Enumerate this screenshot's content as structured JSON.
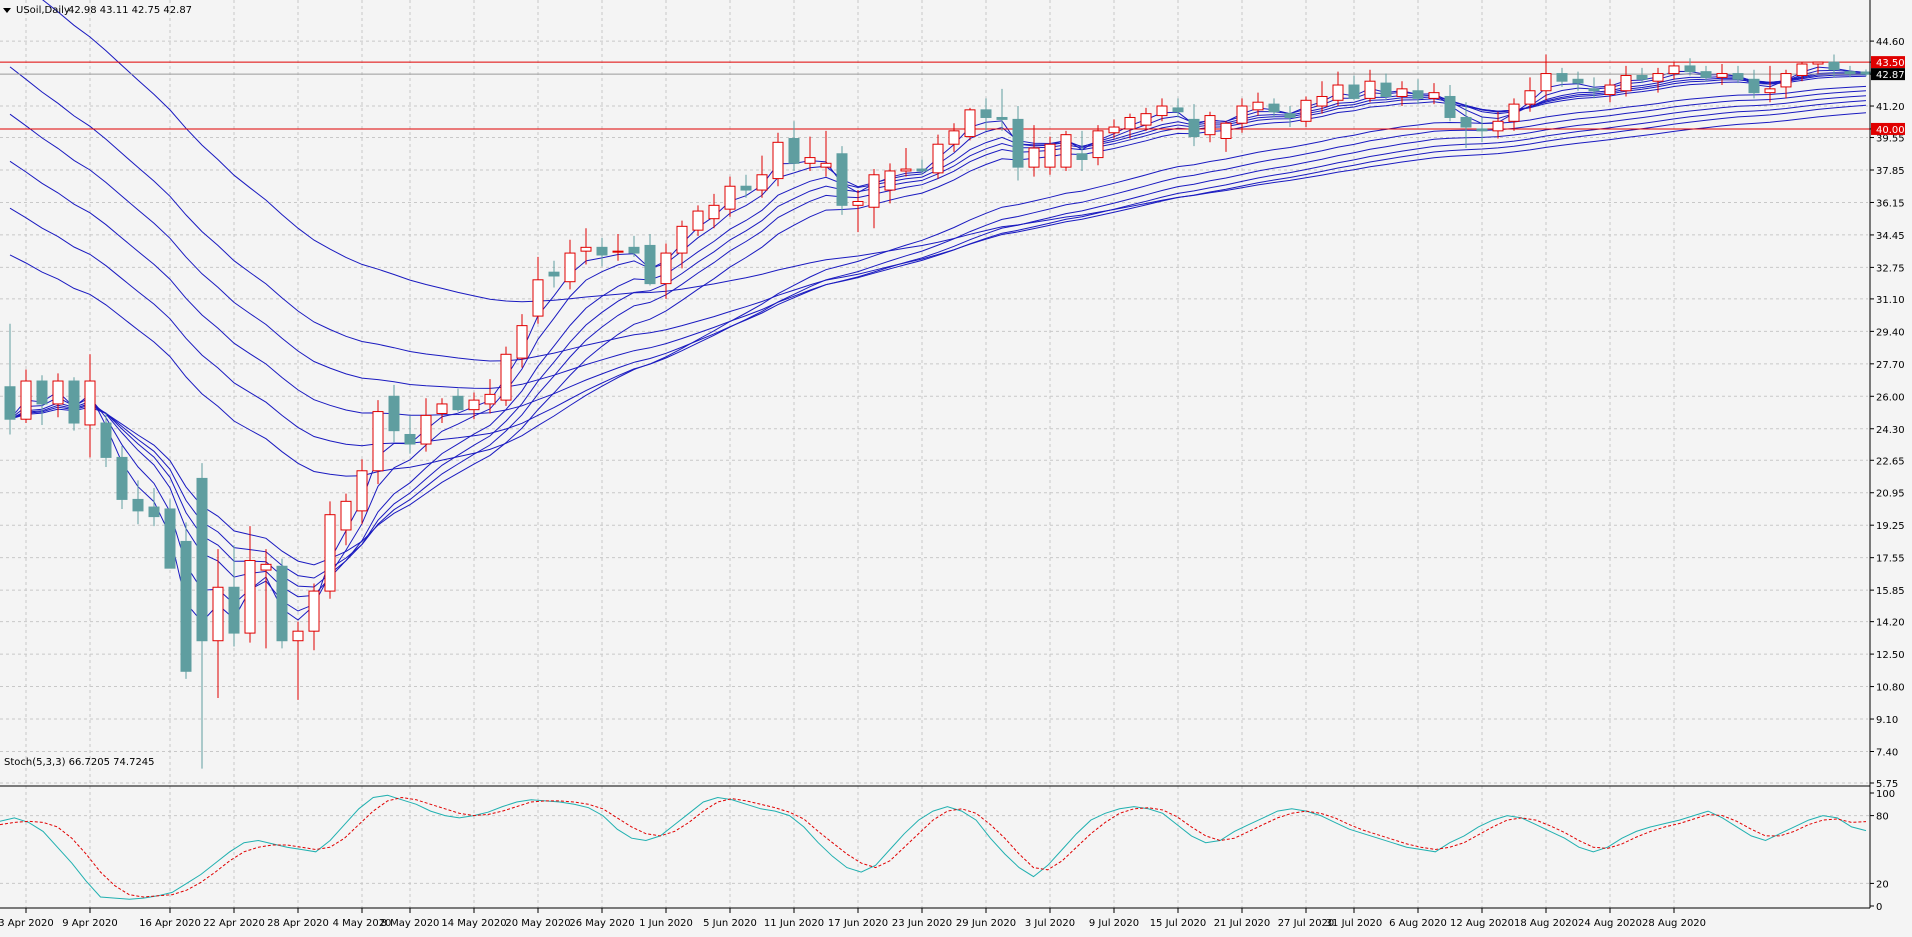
{
  "chart_data": {
    "type": "candlestick",
    "header": {
      "symbol": "USoil,Daily",
      "ohlc": "42.98 43.11 42.75 42.87"
    },
    "y_axis": {
      "range": [
        5.75,
        45.6
      ],
      "ticks": [
        "44.60",
        "43.50",
        "42.87",
        "41.20",
        "40.00",
        "39.55",
        "37.85",
        "36.15",
        "34.45",
        "32.75",
        "31.10",
        "29.40",
        "27.70",
        "26.00",
        "24.30",
        "22.65",
        "20.95",
        "19.25",
        "17.55",
        "15.85",
        "14.20",
        "12.50",
        "10.80",
        "9.10",
        "7.40",
        "5.75"
      ]
    },
    "price_lines": [
      {
        "label": "43.50",
        "value": 43.5,
        "color": "#e00000"
      },
      {
        "label": "40.00",
        "value": 40.0,
        "color": "#e00000"
      }
    ],
    "current_price": {
      "label": "42.87",
      "value": 42.87
    },
    "x_axis": {
      "labels": [
        "3 Apr 2020",
        "9 Apr 2020",
        "16 Apr 2020",
        "22 Apr 2020",
        "28 Apr 2020",
        "4 May 2020",
        "8 May 2020",
        "14 May 2020",
        "20 May 2020",
        "26 May 2020",
        "1 Jun 2020",
        "5 Jun 2020",
        "11 Jun 2020",
        "17 Jun 2020",
        "23 Jun 2020",
        "29 Jun 2020",
        "3 Jul 2020",
        "9 Jul 2020",
        "15 Jul 2020",
        "21 Jul 2020",
        "27 Jul 2020",
        "31 Jul 2020",
        "6 Aug 2020",
        "12 Aug 2020",
        "18 Aug 2020",
        "24 Aug 2020",
        "28 Aug 2020"
      ],
      "label_bar_index": [
        1,
        5,
        10,
        14,
        18,
        22,
        25,
        29,
        33,
        37,
        41,
        45,
        49,
        53,
        57,
        61,
        65,
        69,
        73,
        77,
        81,
        84,
        88,
        92,
        96,
        100,
        104
      ]
    },
    "candles": [
      [
        26.5,
        29.8,
        24.0,
        24.8
      ],
      [
        24.8,
        27.4,
        24.6,
        26.8
      ],
      [
        26.8,
        27.1,
        24.5,
        25.6
      ],
      [
        25.6,
        27.2,
        24.9,
        26.8
      ],
      [
        26.8,
        27.0,
        24.2,
        24.6
      ],
      [
        24.5,
        28.2,
        22.8,
        26.8
      ],
      [
        24.6,
        25.1,
        22.3,
        22.8
      ],
      [
        22.8,
        23.4,
        20.1,
        20.6
      ],
      [
        20.6,
        21.6,
        19.3,
        20.0
      ],
      [
        20.2,
        21.2,
        19.2,
        19.7
      ],
      [
        20.1,
        20.6,
        19.2,
        17.0
      ],
      [
        18.4,
        19.4,
        11.2,
        11.6
      ],
      [
        21.7,
        22.5,
        6.5,
        13.2
      ],
      [
        13.2,
        18.0,
        10.2,
        16.0
      ],
      [
        16.0,
        18.2,
        12.9,
        13.6
      ],
      [
        13.6,
        19.2,
        13.1,
        17.4
      ],
      [
        16.9,
        18.0,
        12.8,
        17.2
      ],
      [
        17.1,
        17.5,
        12.8,
        13.2
      ],
      [
        13.2,
        14.2,
        10.1,
        13.7
      ],
      [
        13.7,
        16.2,
        12.7,
        15.8
      ],
      [
        15.8,
        20.5,
        15.4,
        19.8
      ],
      [
        19.0,
        20.9,
        18.2,
        20.5
      ],
      [
        20.0,
        22.7,
        19.3,
        22.1
      ],
      [
        22.1,
        25.8,
        21.4,
        25.2
      ],
      [
        26.0,
        26.6,
        23.6,
        24.2
      ],
      [
        24.0,
        25.0,
        23.0,
        23.5
      ],
      [
        23.5,
        25.9,
        23.1,
        25.0
      ],
      [
        25.1,
        25.9,
        24.6,
        25.6
      ],
      [
        26.0,
        26.4,
        25.2,
        25.3
      ],
      [
        25.3,
        26.2,
        24.8,
        25.8
      ],
      [
        25.6,
        26.9,
        25.1,
        26.1
      ],
      [
        25.8,
        28.6,
        25.5,
        28.2
      ],
      [
        28.0,
        30.3,
        27.5,
        29.7
      ],
      [
        30.2,
        33.3,
        29.8,
        32.1
      ],
      [
        32.5,
        33.1,
        31.7,
        32.3
      ],
      [
        32.0,
        34.2,
        31.6,
        33.5
      ],
      [
        33.6,
        34.8,
        32.9,
        33.8
      ],
      [
        33.8,
        34.3,
        32.8,
        33.4
      ],
      [
        33.6,
        34.5,
        33.1,
        33.6
      ],
      [
        33.8,
        34.4,
        33.3,
        33.5
      ],
      [
        33.9,
        34.5,
        31.8,
        31.9
      ],
      [
        31.9,
        34.0,
        31.1,
        33.5
      ],
      [
        33.5,
        35.2,
        32.7,
        34.9
      ],
      [
        34.7,
        36.0,
        34.4,
        35.7
      ],
      [
        35.3,
        36.6,
        34.8,
        36.0
      ],
      [
        35.8,
        37.5,
        35.4,
        37.0
      ],
      [
        37.0,
        37.6,
        36.4,
        36.8
      ],
      [
        36.8,
        38.6,
        36.4,
        37.6
      ],
      [
        37.4,
        39.8,
        37.0,
        39.3
      ],
      [
        39.5,
        40.4,
        37.8,
        38.2
      ],
      [
        38.2,
        39.6,
        37.8,
        38.5
      ],
      [
        38.0,
        39.9,
        37.5,
        38.2
      ],
      [
        38.7,
        39.1,
        35.5,
        36.0
      ],
      [
        36.0,
        36.8,
        34.6,
        36.2
      ],
      [
        35.9,
        37.9,
        34.8,
        37.6
      ],
      [
        36.8,
        38.2,
        36.1,
        37.8
      ],
      [
        37.8,
        39.0,
        37.5,
        37.9
      ],
      [
        37.9,
        38.4,
        37.6,
        37.8
      ],
      [
        37.7,
        39.7,
        37.4,
        39.2
      ],
      [
        39.2,
        40.3,
        38.8,
        39.9
      ],
      [
        39.6,
        41.1,
        39.4,
        41.0
      ],
      [
        41.0,
        41.6,
        39.9,
        40.6
      ],
      [
        40.6,
        42.1,
        39.9,
        40.5
      ],
      [
        40.5,
        41.2,
        37.3,
        38.0
      ],
      [
        38.0,
        40.2,
        37.5,
        39.0
      ],
      [
        38.0,
        39.6,
        37.6,
        39.2
      ],
      [
        38.0,
        39.9,
        37.8,
        39.7
      ],
      [
        38.7,
        39.9,
        37.8,
        38.4
      ],
      [
        38.5,
        40.2,
        38.1,
        39.9
      ],
      [
        39.8,
        40.5,
        39.5,
        40.1
      ],
      [
        40.0,
        40.8,
        39.5,
        40.6
      ],
      [
        40.2,
        41.1,
        39.9,
        40.8
      ],
      [
        40.7,
        41.6,
        40.4,
        41.2
      ],
      [
        41.1,
        41.6,
        40.6,
        40.9
      ],
      [
        40.5,
        41.3,
        39.1,
        39.6
      ],
      [
        39.7,
        40.9,
        39.3,
        40.7
      ],
      [
        39.5,
        40.4,
        38.8,
        40.3
      ],
      [
        40.3,
        41.6,
        39.8,
        41.2
      ],
      [
        41.0,
        41.9,
        40.7,
        41.4
      ],
      [
        41.3,
        41.6,
        40.6,
        40.9
      ],
      [
        40.8,
        41.2,
        40.1,
        40.6
      ],
      [
        40.4,
        41.7,
        40.1,
        41.5
      ],
      [
        41.2,
        42.5,
        40.8,
        41.7
      ],
      [
        41.5,
        43.0,
        41.2,
        42.3
      ],
      [
        42.3,
        42.8,
        41.5,
        41.6
      ],
      [
        41.6,
        43.1,
        41.4,
        42.5
      ],
      [
        42.4,
        42.9,
        41.5,
        41.7
      ],
      [
        41.7,
        42.5,
        41.2,
        42.1
      ],
      [
        42.0,
        42.6,
        41.3,
        41.6
      ],
      [
        41.6,
        42.4,
        41.3,
        41.9
      ],
      [
        41.7,
        42.3,
        40.4,
        40.6
      ],
      [
        40.6,
        41.4,
        39.0,
        40.1
      ],
      [
        40.0,
        40.6,
        39.3,
        39.9
      ],
      [
        39.9,
        40.9,
        39.5,
        40.4
      ],
      [
        40.4,
        41.6,
        39.9,
        41.3
      ],
      [
        41.3,
        42.7,
        40.9,
        42.0
      ],
      [
        42.0,
        43.9,
        41.5,
        42.9
      ],
      [
        42.9,
        43.2,
        42.2,
        42.5
      ],
      [
        42.6,
        43.0,
        42.0,
        42.4
      ],
      [
        42.1,
        42.7,
        41.6,
        42.0
      ],
      [
        41.8,
        42.6,
        41.4,
        42.3
      ],
      [
        42.0,
        43.3,
        41.7,
        42.8
      ],
      [
        42.8,
        43.2,
        42.4,
        42.6
      ],
      [
        42.5,
        43.2,
        41.9,
        42.9
      ],
      [
        42.9,
        43.5,
        42.6,
        43.3
      ],
      [
        43.3,
        43.7,
        42.8,
        43.0
      ],
      [
        43.0,
        43.3,
        42.5,
        42.7
      ],
      [
        42.7,
        43.4,
        42.3,
        42.9
      ],
      [
        42.9,
        43.3,
        42.4,
        42.6
      ],
      [
        42.6,
        43.1,
        41.6,
        41.9
      ],
      [
        41.9,
        43.3,
        41.4,
        42.1
      ],
      [
        42.2,
        43.1,
        41.6,
        42.9
      ],
      [
        42.8,
        43.5,
        42.5,
        43.4
      ],
      [
        43.4,
        43.5,
        42.9,
        43.5
      ],
      [
        43.5,
        43.9,
        42.7,
        43.1
      ],
      [
        43.0,
        43.3,
        42.7,
        42.9
      ],
      [
        42.98,
        43.11,
        42.75,
        42.87
      ]
    ],
    "indicators": {
      "moving_averages": {
        "color": "#1a1ac0",
        "count": 12
      },
      "stochastic": {
        "label": "Stoch(5,3,3) 66.7205 74.7245",
        "axis_ticks": [
          "100",
          "80",
          "20",
          "0"
        ],
        "main_color": "#20b0b0",
        "signal_color": "#e00000",
        "main": [
          75,
          78,
          74,
          66,
          52,
          38,
          22,
          8,
          7,
          6,
          7,
          9,
          12,
          20,
          28,
          38,
          48,
          56,
          58,
          55,
          52,
          50,
          48,
          58,
          72,
          86,
          96,
          98,
          94,
          90,
          84,
          80,
          78,
          80,
          83,
          88,
          92,
          94,
          93,
          92,
          90,
          87,
          80,
          68,
          60,
          58,
          62,
          72,
          82,
          92,
          96,
          94,
          90,
          86,
          84,
          80,
          70,
          56,
          44,
          34,
          30,
          36,
          50,
          64,
          76,
          84,
          88,
          84,
          76,
          60,
          46,
          34,
          26,
          36,
          50,
          64,
          76,
          82,
          86,
          88,
          86,
          82,
          72,
          62,
          56,
          58,
          66,
          72,
          78,
          84,
          86,
          84,
          80,
          74,
          68,
          64,
          60,
          56,
          52,
          50,
          48,
          56,
          62,
          70,
          76,
          80,
          78,
          72,
          66,
          60,
          52,
          48,
          52,
          60,
          66,
          70,
          73,
          76,
          80,
          84,
          78,
          70,
          62,
          58,
          64,
          70,
          76,
          80,
          78,
          70,
          66.7
        ],
        "signal": [
          72,
          74,
          75,
          74,
          70,
          60,
          46,
          30,
          18,
          10,
          8,
          9,
          10,
          14,
          21,
          30,
          40,
          48,
          52,
          54,
          54,
          52,
          50,
          52,
          60,
          72,
          84,
          93,
          96,
          94,
          90,
          86,
          82,
          80,
          81,
          84,
          88,
          92,
          93,
          93,
          92,
          90,
          86,
          78,
          70,
          64,
          62,
          66,
          74,
          84,
          92,
          95,
          93,
          90,
          87,
          83,
          77,
          66,
          56,
          46,
          38,
          34,
          40,
          52,
          64,
          76,
          84,
          86,
          82,
          72,
          60,
          46,
          34,
          32,
          40,
          52,
          64,
          74,
          82,
          86,
          87,
          85,
          79,
          70,
          62,
          58,
          60,
          66,
          72,
          78,
          82,
          84,
          82,
          78,
          72,
          67,
          63,
          59,
          55,
          52,
          50,
          52,
          56,
          63,
          70,
          76,
          78,
          76,
          71,
          65,
          58,
          52,
          51,
          55,
          61,
          66,
          70,
          73,
          77,
          81,
          80,
          75,
          68,
          62,
          62,
          66,
          72,
          76,
          77,
          74,
          74.7
        ]
      }
    }
  }
}
